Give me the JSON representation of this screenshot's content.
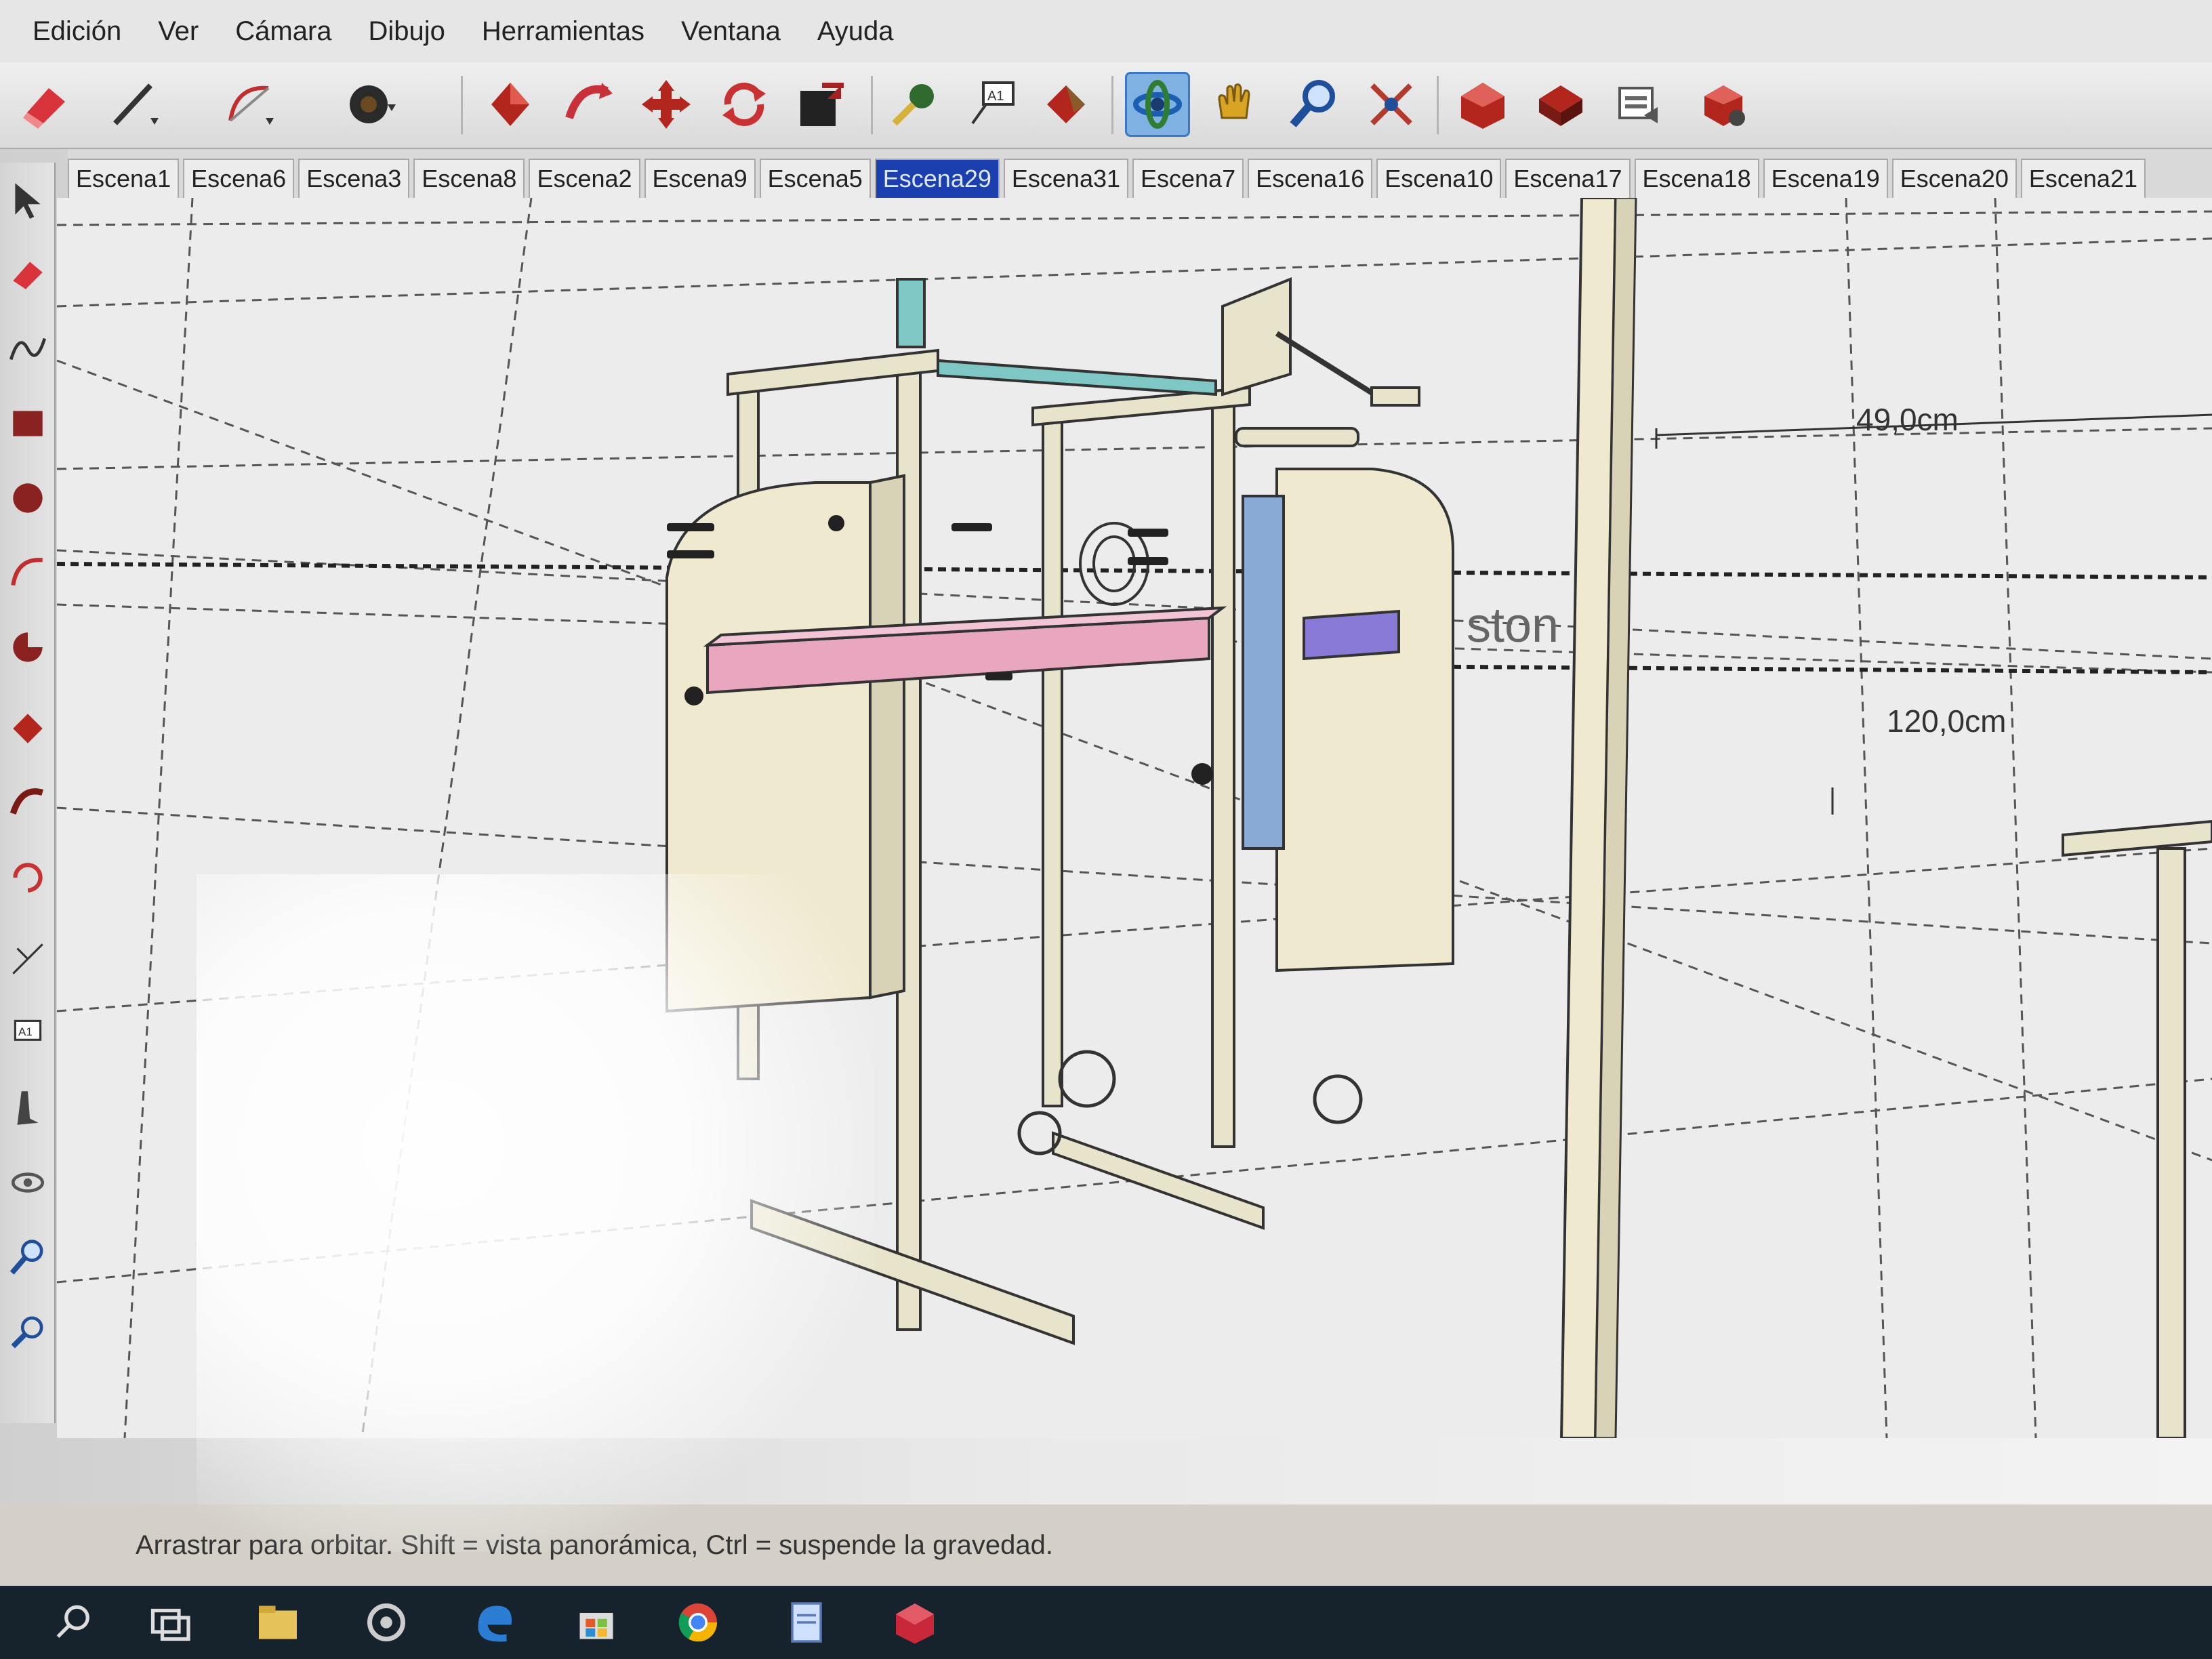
{
  "menu": {
    "items": [
      "Edición",
      "Ver",
      "Cámara",
      "Dibujo",
      "Herramientas",
      "Ventana",
      "Ayuda"
    ]
  },
  "toolbar": {
    "tools": [
      {
        "name": "eraser-icon",
        "color": "#d9343b"
      },
      {
        "name": "pencil-icon",
        "color": "#333333"
      },
      {
        "name": "arc-icon",
        "color": "#c22e2e"
      },
      {
        "name": "circle-icon",
        "color": "#333333"
      },
      {
        "name": "push-pull-icon",
        "color": "#b3261e"
      },
      {
        "name": "follow-me-icon",
        "color": "#c8303a"
      },
      {
        "name": "move-icon",
        "color": "#b3261e"
      },
      {
        "name": "rotate-icon",
        "color": "#c83232"
      },
      {
        "name": "scale-icon",
        "color": "#a52222"
      },
      {
        "name": "tape-measure-icon",
        "color": "#2f6b2f"
      },
      {
        "name": "text-icon",
        "color": "#333333"
      },
      {
        "name": "paint-bucket-icon",
        "color": "#b3261e"
      },
      {
        "name": "orbit-icon",
        "color": "#1b5fb0",
        "active": true
      },
      {
        "name": "pan-icon",
        "color": "#d7a424"
      },
      {
        "name": "zoom-icon",
        "color": "#1f4f9a"
      },
      {
        "name": "zoom-extents-icon",
        "color": "#b33a2e"
      },
      {
        "name": "warehouse-icon",
        "color": "#b3261e"
      },
      {
        "name": "share-model-icon",
        "color": "#b3261e"
      },
      {
        "name": "components-icon",
        "color": "#666666"
      },
      {
        "name": "extension-warehouse-icon",
        "color": "#b3261e"
      }
    ]
  },
  "tabs": [
    {
      "label": "Escena1",
      "active": false
    },
    {
      "label": "Escena6",
      "active": false
    },
    {
      "label": "Escena3",
      "active": false
    },
    {
      "label": "Escena8",
      "active": false
    },
    {
      "label": "Escena2",
      "active": false
    },
    {
      "label": "Escena9",
      "active": false
    },
    {
      "label": "Escena5",
      "active": false
    },
    {
      "label": "Escena29",
      "active": true
    },
    {
      "label": "Escena31",
      "active": false
    },
    {
      "label": "Escena7",
      "active": false
    },
    {
      "label": "Escena16",
      "active": false
    },
    {
      "label": "Escena10",
      "active": false
    },
    {
      "label": "Escena17",
      "active": false
    },
    {
      "label": "Escena18",
      "active": false
    },
    {
      "label": "Escena19",
      "active": false
    },
    {
      "label": "Escena20",
      "active": false
    },
    {
      "label": "Escena21",
      "active": false
    }
  ],
  "left_tools": [
    "select-icon",
    "eraser-icon",
    "freehand-icon",
    "rectangle-icon",
    "circle-icon",
    "arc-icon",
    "pie-icon",
    "push-pull-icon",
    "offset-icon",
    "rotate-icon",
    "dimension-icon",
    "text-icon",
    "walk-icon",
    "look-around-icon",
    "zoom-icon",
    "zoom-window-icon"
  ],
  "viewport": {
    "dimension_1": "49,0cm",
    "dimension_2": "120,0cm",
    "model_text": "ston"
  },
  "status": {
    "text": "Arrastrar para orbitar. Shift = vista panorámica, Ctrl = suspende la gravedad."
  },
  "taskbar": {
    "apps": [
      "search-icon",
      "task-view-icon",
      "file-explorer-icon",
      "media-icon",
      "edge-icon",
      "store-icon",
      "chrome-icon",
      "document-icon",
      "sketchup-icon"
    ]
  },
  "colors": {
    "accent_tab": "#1c3fb0",
    "frame": "#e8e4cc",
    "pink_beam": "#e8a6bf",
    "teal_beam": "#7fc7c4",
    "purple_block": "#8a7ad8",
    "blue_plate": "#8aaad6"
  }
}
